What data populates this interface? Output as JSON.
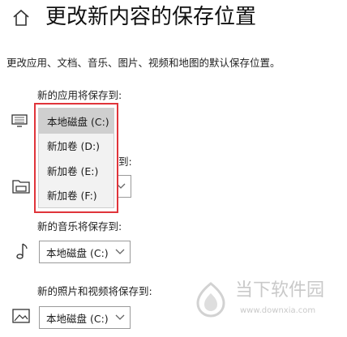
{
  "header": {
    "title": "更改新内容的保存位置",
    "home_icon": "home-icon"
  },
  "description": "更改应用、文档、音乐、图片、视频和地图的默认保存位置。",
  "apps": {
    "label": "新的应用将保存到:",
    "icon": "monitor-icon",
    "selected": "本地磁盘 (C:)"
  },
  "dropdown": {
    "options": [
      "本地磁盘 (C:)",
      "新加卷 (D:)",
      "新加卷 (E:)",
      "新加卷 (F:)"
    ],
    "highlight_color": "#e0343a"
  },
  "documents": {
    "label_tail": "到:",
    "icon": "folder-icon"
  },
  "music": {
    "label": "新的音乐将保存到:",
    "icon": "music-note-icon",
    "selected": "本地磁盘 (C:)"
  },
  "photos": {
    "label": "新的照片和视频将保存到:",
    "icon": "picture-icon",
    "selected": "本地磁盘 (C:)"
  },
  "watermark": {
    "text": "当下软件园",
    "url": "www.downxia.com"
  }
}
